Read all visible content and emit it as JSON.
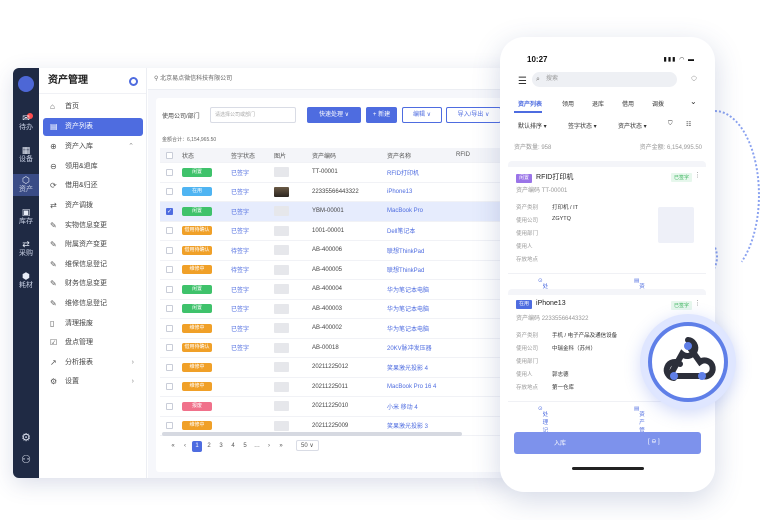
{
  "rail": {
    "items": [
      {
        "label": "待办",
        "glyph": "✉"
      },
      {
        "label": "设备",
        "glyph": "▦"
      },
      {
        "label": "资产",
        "glyph": "⬡"
      },
      {
        "label": "库存",
        "glyph": "▣"
      },
      {
        "label": "采购",
        "glyph": "⇄"
      },
      {
        "label": "耗材",
        "glyph": "⬢"
      }
    ]
  },
  "sidebar": {
    "title": "资产管理",
    "items": [
      {
        "label": "首页",
        "icon": "⌂"
      },
      {
        "label": "资产列表",
        "icon": "▤"
      },
      {
        "label": "资产入库",
        "icon": "⊕"
      },
      {
        "label": "领用&退库",
        "icon": "⊖"
      },
      {
        "label": "借用&归还",
        "icon": "⟳"
      },
      {
        "label": "资产调拨",
        "icon": "⇄"
      },
      {
        "label": "实物信息变更",
        "icon": "✎"
      },
      {
        "label": "附属资产变更",
        "icon": "✎"
      },
      {
        "label": "维保信息登记",
        "icon": "✎"
      },
      {
        "label": "财务信息变更",
        "icon": "✎"
      },
      {
        "label": "维修信息登记",
        "icon": "✎"
      },
      {
        "label": "清理报废",
        "icon": "▯"
      },
      {
        "label": "盘点管理",
        "icon": "☑"
      },
      {
        "label": "分析报表",
        "icon": "↗"
      },
      {
        "label": "设置",
        "icon": "⚙"
      }
    ]
  },
  "breadcrumb": "北京易点微信科技有限公司",
  "toolbar": {
    "company_label": "使用公司/部门",
    "company_placeholder": "请选择公司或部门",
    "quick_action": "快速处理 ∨",
    "new": "+ 新建",
    "edit": "编辑 ∨",
    "import_export": "导入/导出 ∨"
  },
  "total": "金额合计：6,154,965.50",
  "table": {
    "headers": [
      "状态",
      "签字状态",
      "图片",
      "资产编码",
      "资产名称",
      "RFID"
    ],
    "rows": [
      {
        "status": "闲置",
        "status_color": "#3fc26b",
        "sign": "已签字",
        "img": "",
        "code": "TT-00001",
        "name": "RFID打印机"
      },
      {
        "status": "在用",
        "status_color": "#4fb4f2",
        "sign": "已签字",
        "img": "dark",
        "code": "22335566443322",
        "name": "iPhone13"
      },
      {
        "status": "闲置",
        "status_color": "#3fc26b",
        "sign": "已签字",
        "img": "",
        "code": "YBM-00001",
        "name": "MacBook Pro",
        "selected": true
      },
      {
        "status": "借用待确认",
        "status_color": "#f0a028",
        "sign": "已签字",
        "img": "",
        "code": "1001-00001",
        "name": "Dell笔记本"
      },
      {
        "status": "借用待确认",
        "status_color": "#f0a028",
        "sign": "待签字",
        "img": "",
        "code": "AB-400006",
        "name": "联想ThinkPad"
      },
      {
        "status": "维修中",
        "status_color": "#f0a028",
        "sign": "待签字",
        "img": "",
        "code": "AB-400005",
        "name": "联想ThinkPad"
      },
      {
        "status": "闲置",
        "status_color": "#3fc26b",
        "sign": "已签字",
        "img": "",
        "code": "AB-400004",
        "name": "华为笔记本电脑"
      },
      {
        "status": "闲置",
        "status_color": "#3fc26b",
        "sign": "已签字",
        "img": "",
        "code": "AB-400003",
        "name": "华为笔记本电脑"
      },
      {
        "status": "维修中",
        "status_color": "#f0a028",
        "sign": "已签字",
        "img": "",
        "code": "AB-400002",
        "name": "华为笔记本电脑"
      },
      {
        "status": "借用待确认",
        "status_color": "#f0a028",
        "sign": "已签字",
        "img": "",
        "code": "AB-00018",
        "name": "20KV脉冲发压器"
      },
      {
        "status": "维修中",
        "status_color": "#f0a028",
        "sign": "",
        "img": "",
        "code": "20211225012",
        "name": "笑果激光投影 4"
      },
      {
        "status": "维修中",
        "status_color": "#f0a028",
        "sign": "",
        "img": "",
        "code": "20211225011",
        "name": "MacBook Pro 16 4"
      },
      {
        "status": "报废",
        "status_color": "#f0718b",
        "sign": "",
        "img": "",
        "code": "20211225010",
        "name": "小米 移动 4"
      },
      {
        "status": "维修中",
        "status_color": "#f0a028",
        "sign": "",
        "img": "",
        "code": "20211225009",
        "name": "笑果激光投影 3"
      }
    ]
  },
  "pagination": {
    "pages": [
      "«",
      "‹",
      "1",
      "2",
      "3",
      "4",
      "5",
      "…",
      "›",
      "»"
    ],
    "current": "1",
    "page_size": "50 ∨"
  },
  "phone": {
    "time": "10:27",
    "status_icons": "▮▮▮ ◠ ▬",
    "search_placeholder": "搜索",
    "tabs": [
      "资产列表",
      "领用",
      "退库",
      "借用",
      "调拨"
    ],
    "filters": [
      "默认排序 ▾",
      "签字状态 ▾",
      "资产状态 ▾"
    ],
    "summary_left": "资产数量: 958",
    "summary_right": "资产金额: 6,154,995.50",
    "cards": [
      {
        "badge": "闲置",
        "badge_color": "#9a74e8",
        "title": "RFID打印机",
        "status": "已签字",
        "code_label": "资产编码",
        "code": "TT-00001",
        "fields": [
          [
            "资产类别",
            "打印机 / IT"
          ],
          [
            "使用公司",
            "ZGYTQ"
          ],
          [
            "使用部门",
            ""
          ],
          [
            "使用人",
            ""
          ],
          [
            "存放地点",
            ""
          ]
        ],
        "act1": "处理记录",
        "act2": "资产管理"
      },
      {
        "badge": "在用",
        "badge_color": "#4e6ce0",
        "title": "iPhone13",
        "status": "已签字",
        "code_label": "资产编码",
        "code": "22335566443322",
        "fields": [
          [
            "资产类别",
            "手机 / 电子产品及通信设备"
          ],
          [
            "使用公司",
            "中瑞金科（苏州）"
          ],
          [
            "使用部门",
            ""
          ],
          [
            "使用人",
            "郭志德"
          ],
          [
            "存放地点",
            "第一仓库"
          ]
        ],
        "act1": "处理记录",
        "act2": "资产管理"
      }
    ],
    "bottom_left": "入库",
    "bottom_right": "[ ⊖ ]"
  }
}
